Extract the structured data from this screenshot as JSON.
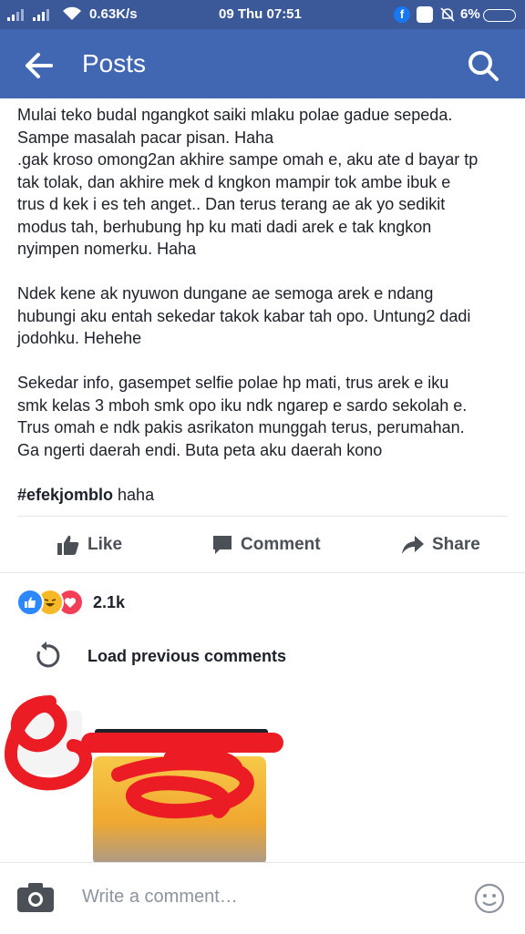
{
  "status_bar": {
    "speed": "0.63K/s",
    "date_time": "09 Thu  07:51",
    "battery": "6%"
  },
  "app_bar": {
    "title": "Posts"
  },
  "post": {
    "paragraphs": [
      "Mulai teko budal ngangkot saiki mlaku polae gadue sepeda.\nSampe masalah pacar pisan. Haha\n.gak kroso omong2an akhire sampe omah e, aku ate d bayar tp\ntak tolak, dan akhire mek d kngkon mampir tok ambe ibuk e\ntrus d kek i es teh anget.. Dan terus terang ae ak yo sedikit\nmodus tah, berhubung hp ku mati dadi arek e tak kngkon\nnyimpen nomerku. Haha",
      "Ndek kene ak nyuwon dungane ae semoga arek e ndang\nhubungi aku entah sekedar takok kabar tah opo. Untung2 dadi\njodohku. Hehehe",
      "Sekedar info, gasempet selfie polae hp mati, trus arek e iku\nsmk kelas 3 mboh smk opo iku ndk ngarep e sardo sekolah e.\nTrus omah e ndk pakis asrikaton munggah terus, perumahan.\nGa ngerti daerah endi. Buta peta aku daerah kono"
    ],
    "hashtag": "#efekjomblo",
    "hashtag_suffix": " haha"
  },
  "actions": {
    "like": "Like",
    "comment": "Comment",
    "share": "Share"
  },
  "reactions": {
    "count": "2.1k"
  },
  "comments": {
    "load_previous": "Load previous comments"
  },
  "composer": {
    "placeholder": "Write a comment…"
  },
  "colors": {
    "status_bar": "#3b5998",
    "app_bar": "#4267b2",
    "like_blue": "#2d88ff",
    "love_red": "#f33e58",
    "haha_yellow": "#f7b928"
  }
}
